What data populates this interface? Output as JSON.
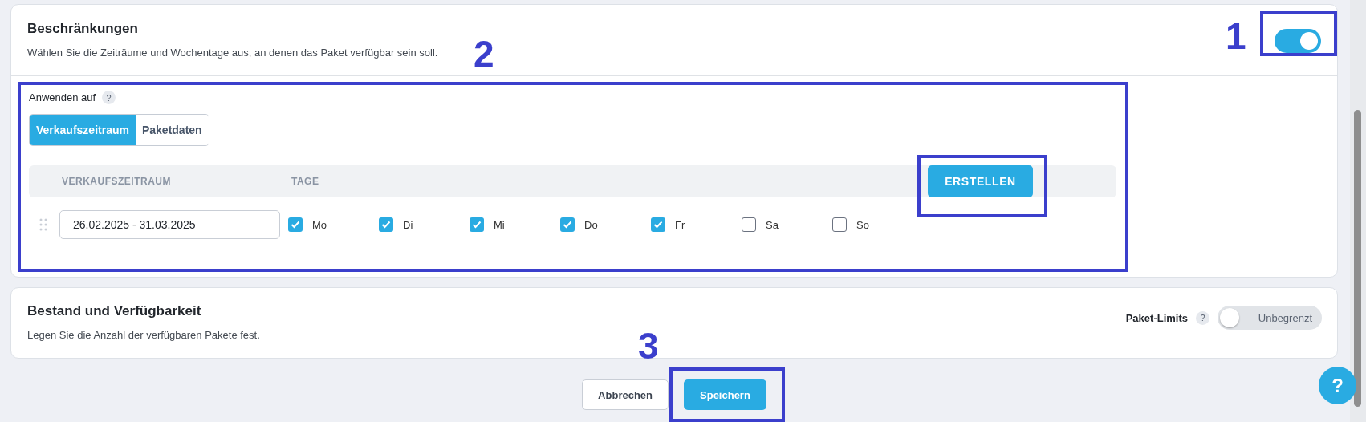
{
  "restrictions": {
    "title": "Beschränkungen",
    "description": "Wählen Sie die Zeiträume und Wochentage aus, an denen das Paket verfügbar sein soll.",
    "enabled": true,
    "apply_to": {
      "label": "Anwenden auf",
      "help": "?",
      "options": [
        {
          "label": "Verkaufszeitraum",
          "selected": true
        },
        {
          "label": "Paketdaten",
          "selected": false
        }
      ]
    },
    "table": {
      "columns": [
        "VERKAUFSZEITRAUM",
        "TAGE"
      ],
      "create_button": "ERSTELLEN",
      "rows": [
        {
          "period": "26.02.2025 - 31.03.2025",
          "days": [
            {
              "label": "Mo",
              "checked": true
            },
            {
              "label": "Di",
              "checked": true
            },
            {
              "label": "Mi",
              "checked": true
            },
            {
              "label": "Do",
              "checked": true
            },
            {
              "label": "Fr",
              "checked": true
            },
            {
              "label": "Sa",
              "checked": false
            },
            {
              "label": "So",
              "checked": false
            }
          ]
        }
      ]
    }
  },
  "stock": {
    "title": "Bestand und Verfügbarkeit",
    "description": "Legen Sie die Anzahl der verfügbaren Pakete fest.",
    "limits_label": "Paket-Limits",
    "help": "?",
    "toggle": {
      "label": "Unbegrenzt",
      "on": false
    }
  },
  "footer": {
    "buttons": [
      {
        "label": "Abbrechen",
        "kind": "secondary"
      },
      {
        "label": "Speichern",
        "kind": "primary"
      }
    ]
  },
  "help_button": "?",
  "annotations": [
    {
      "kind": "numbered",
      "label": "1"
    },
    {
      "kind": "numbered",
      "label": "2"
    },
    {
      "kind": "frame"
    },
    {
      "kind": "numbered",
      "label": "3"
    }
  ]
}
